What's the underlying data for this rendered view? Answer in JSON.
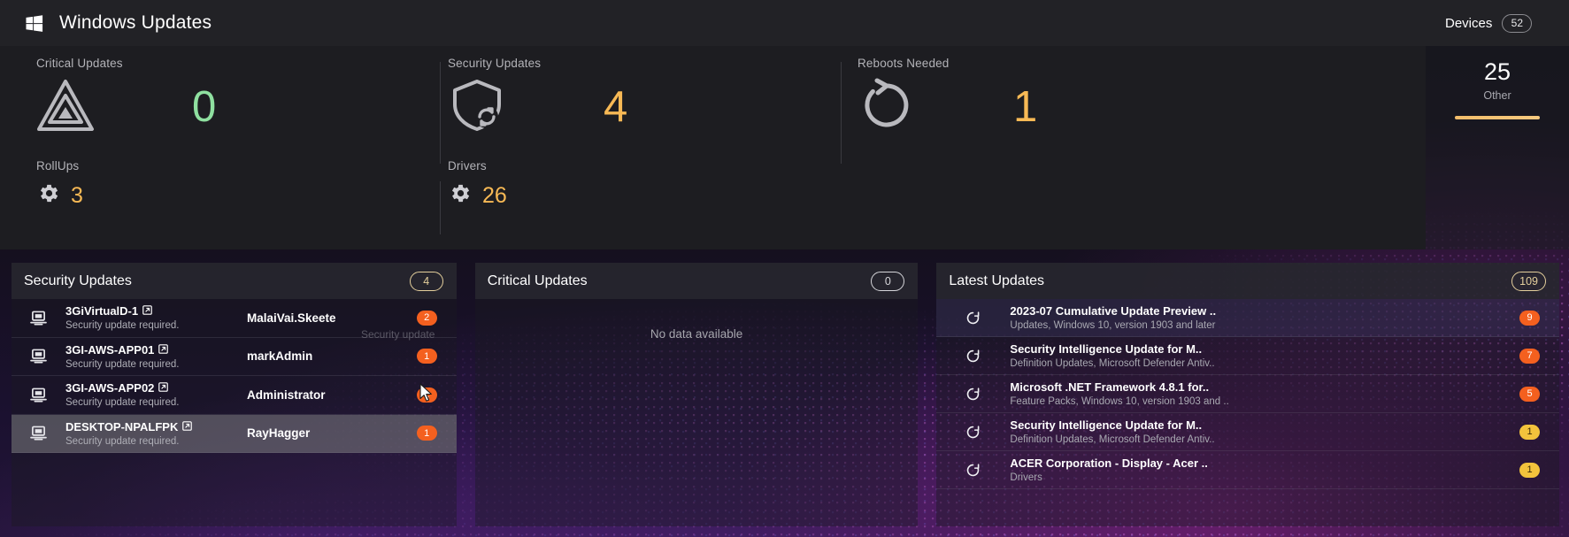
{
  "window": {
    "title": "Windows Updates",
    "logo_icon": "windows-logo-icon"
  },
  "kpis": [
    {
      "label": "Critical Updates",
      "value": "0",
      "icon": "warning-triangle-icon",
      "color": "#8fe0a0"
    },
    {
      "label": "Security Updates",
      "value": "4",
      "icon": "shield-refresh-icon",
      "color": "#f7b955"
    },
    {
      "label": "Reboots Needed",
      "value": "1",
      "icon": "reboot-icon",
      "color": "#f7b955"
    },
    {
      "label": "RollUps",
      "value": "3",
      "icon": "gear-icon",
      "color": "#f7b955"
    },
    {
      "label": "Drivers",
      "value": "26",
      "icon": "gear-icon",
      "color": "#f7b955"
    }
  ],
  "devices": {
    "title": "Devices",
    "count_badge": "52",
    "big_number": "25",
    "sub_label": "Other"
  },
  "security_panel": {
    "title": "Security Updates",
    "count_badge": "4",
    "rows": [
      {
        "name": "3GiVirtualD-1",
        "sub": "Security update required.",
        "user": "MalaiVai.Skeete",
        "badge": "2",
        "icon": "computer-icon",
        "link_icon": "external-link-icon",
        "highlighted": false
      },
      {
        "name": "3GI-AWS-APP01",
        "sub": "Security update required.",
        "user": "markAdmin",
        "badge": "1",
        "icon": "computer-icon",
        "link_icon": "external-link-icon",
        "highlighted": false
      },
      {
        "name": "3GI-AWS-APP02",
        "sub": "Security update required.",
        "user": "Administrator",
        "badge": "1",
        "icon": "computer-icon",
        "link_icon": "external-link-icon",
        "highlighted": false
      },
      {
        "name": "DESKTOP-NPALFPK",
        "sub": "Security update required.",
        "user": "RayHagger",
        "badge": "1",
        "icon": "computer-icon",
        "link_icon": "external-link-icon",
        "highlighted": true
      }
    ],
    "ghost_text": "Security update"
  },
  "critical_panel": {
    "title": "Critical Updates",
    "count_badge": "0",
    "empty_message": "No data available"
  },
  "latest_panel": {
    "title": "Latest Updates",
    "count_badge": "109",
    "rows": [
      {
        "title": "2023-07 Cumulative Update Preview ..",
        "sub": "Updates, Windows 10, version 1903 and later",
        "badge": "9",
        "badge_style": "orange",
        "icon": "update-refresh-icon"
      },
      {
        "title": "Security Intelligence Update for M..",
        "sub": "Definition Updates, Microsoft Defender Antiv..",
        "badge": "7",
        "badge_style": "orange",
        "icon": "update-refresh-icon"
      },
      {
        "title": "Microsoft .NET Framework 4.8.1 for..",
        "sub": "Feature Packs, Windows 10, version 1903 and ..",
        "badge": "5",
        "badge_style": "orange",
        "icon": "update-refresh-icon"
      },
      {
        "title": "Security Intelligence Update for M..",
        "sub": "Definition Updates, Microsoft Defender Antiv..",
        "badge": "1",
        "badge_style": "yellow",
        "icon": "update-refresh-icon"
      },
      {
        "title": "ACER Corporation - Display - Acer ..",
        "sub": "Drivers",
        "badge": "1",
        "badge_style": "yellow",
        "icon": "update-refresh-icon"
      }
    ]
  }
}
